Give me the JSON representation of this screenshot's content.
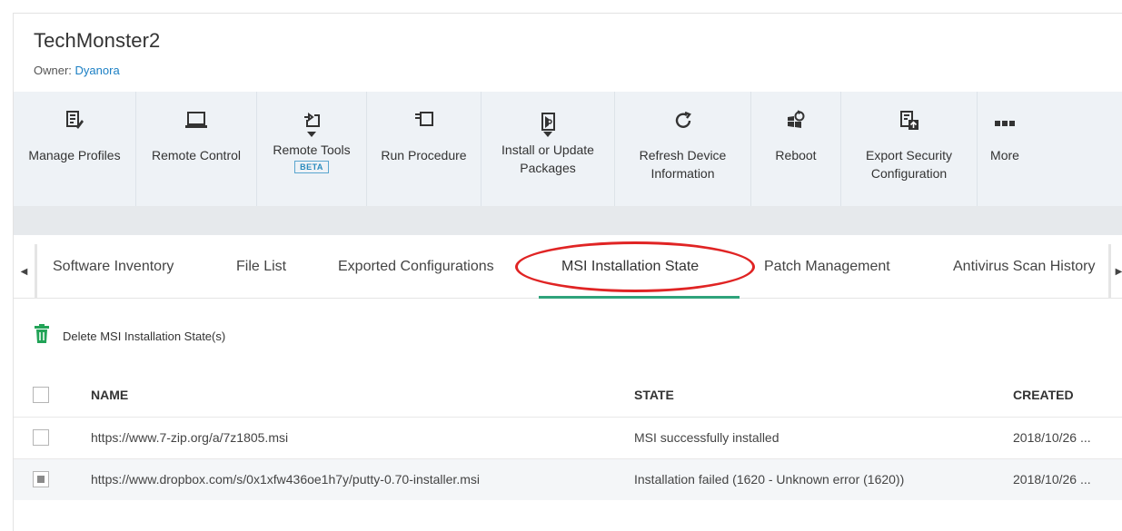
{
  "device": {
    "title": "TechMonster2",
    "owner_label": "Owner:",
    "owner_name": "Dyanora"
  },
  "toolbar": [
    {
      "name": "manage-profiles",
      "label": "Manage Profiles",
      "icon": "edit-document-icon",
      "caret": false,
      "beta": false,
      "width": 135
    },
    {
      "name": "remote-control",
      "label": "Remote Control",
      "icon": "laptop-icon",
      "caret": false,
      "beta": false,
      "width": 133
    },
    {
      "name": "remote-tools",
      "label": "Remote Tools",
      "icon": "remote-tools-icon",
      "caret": true,
      "beta": true,
      "beta_label": "BETA",
      "width": 121
    },
    {
      "name": "run-procedure",
      "label": "Run Procedure",
      "icon": "procedure-icon",
      "caret": false,
      "beta": false,
      "width": 126
    },
    {
      "name": "install-update-packages",
      "label": "Install or Update\nPackages",
      "icon": "package-icon",
      "caret": true,
      "beta": false,
      "width": 147
    },
    {
      "name": "refresh-device-information",
      "label": "Refresh Device\nInformation",
      "icon": "refresh-icon",
      "caret": false,
      "beta": false,
      "width": 150
    },
    {
      "name": "reboot",
      "label": "Reboot",
      "icon": "reboot-icon",
      "caret": false,
      "beta": false,
      "width": 99
    },
    {
      "name": "export-security-configuration",
      "label": "Export Security\nConfiguration",
      "icon": "export-config-icon",
      "caret": false,
      "beta": false,
      "width": 150
    },
    {
      "name": "more",
      "label": "More",
      "icon": "more-icon",
      "caret": false,
      "beta": false,
      "width": 60
    }
  ],
  "tabs": [
    {
      "name": "software-inventory",
      "label": "Software Inventory"
    },
    {
      "name": "file-list",
      "label": "File List"
    },
    {
      "name": "exported-configurations",
      "label": "Exported Configurations"
    },
    {
      "name": "msi-installation-state",
      "label": "MSI Installation State",
      "active": true
    },
    {
      "name": "patch-management",
      "label": "Patch Management"
    },
    {
      "name": "antivirus-scan-history",
      "label": "Antivirus Scan History"
    }
  ],
  "actions": {
    "delete_label": "Delete MSI Installation State(s)"
  },
  "table": {
    "columns": [
      "NAME",
      "STATE",
      "CREATED"
    ],
    "rows": [
      {
        "name": "https://www.7-zip.org/a/7z1805.msi",
        "state": "MSI successfully installed",
        "created": "2018/10/26 ...",
        "checked": false
      },
      {
        "name": "https://www.dropbox.com/s/0x1xfw436oe1h7y/putty-0.70-installer.msi",
        "state": "Installation failed (1620 - Unknown error (1620))",
        "created": "2018/10/26 ...",
        "checked": true
      }
    ]
  },
  "colors": {
    "accent": "#2fa37b",
    "link": "#1b7fc4",
    "highlight": "#e02424",
    "toolbar_bg": "#eef2f6",
    "delete_icon": "#22a357"
  }
}
